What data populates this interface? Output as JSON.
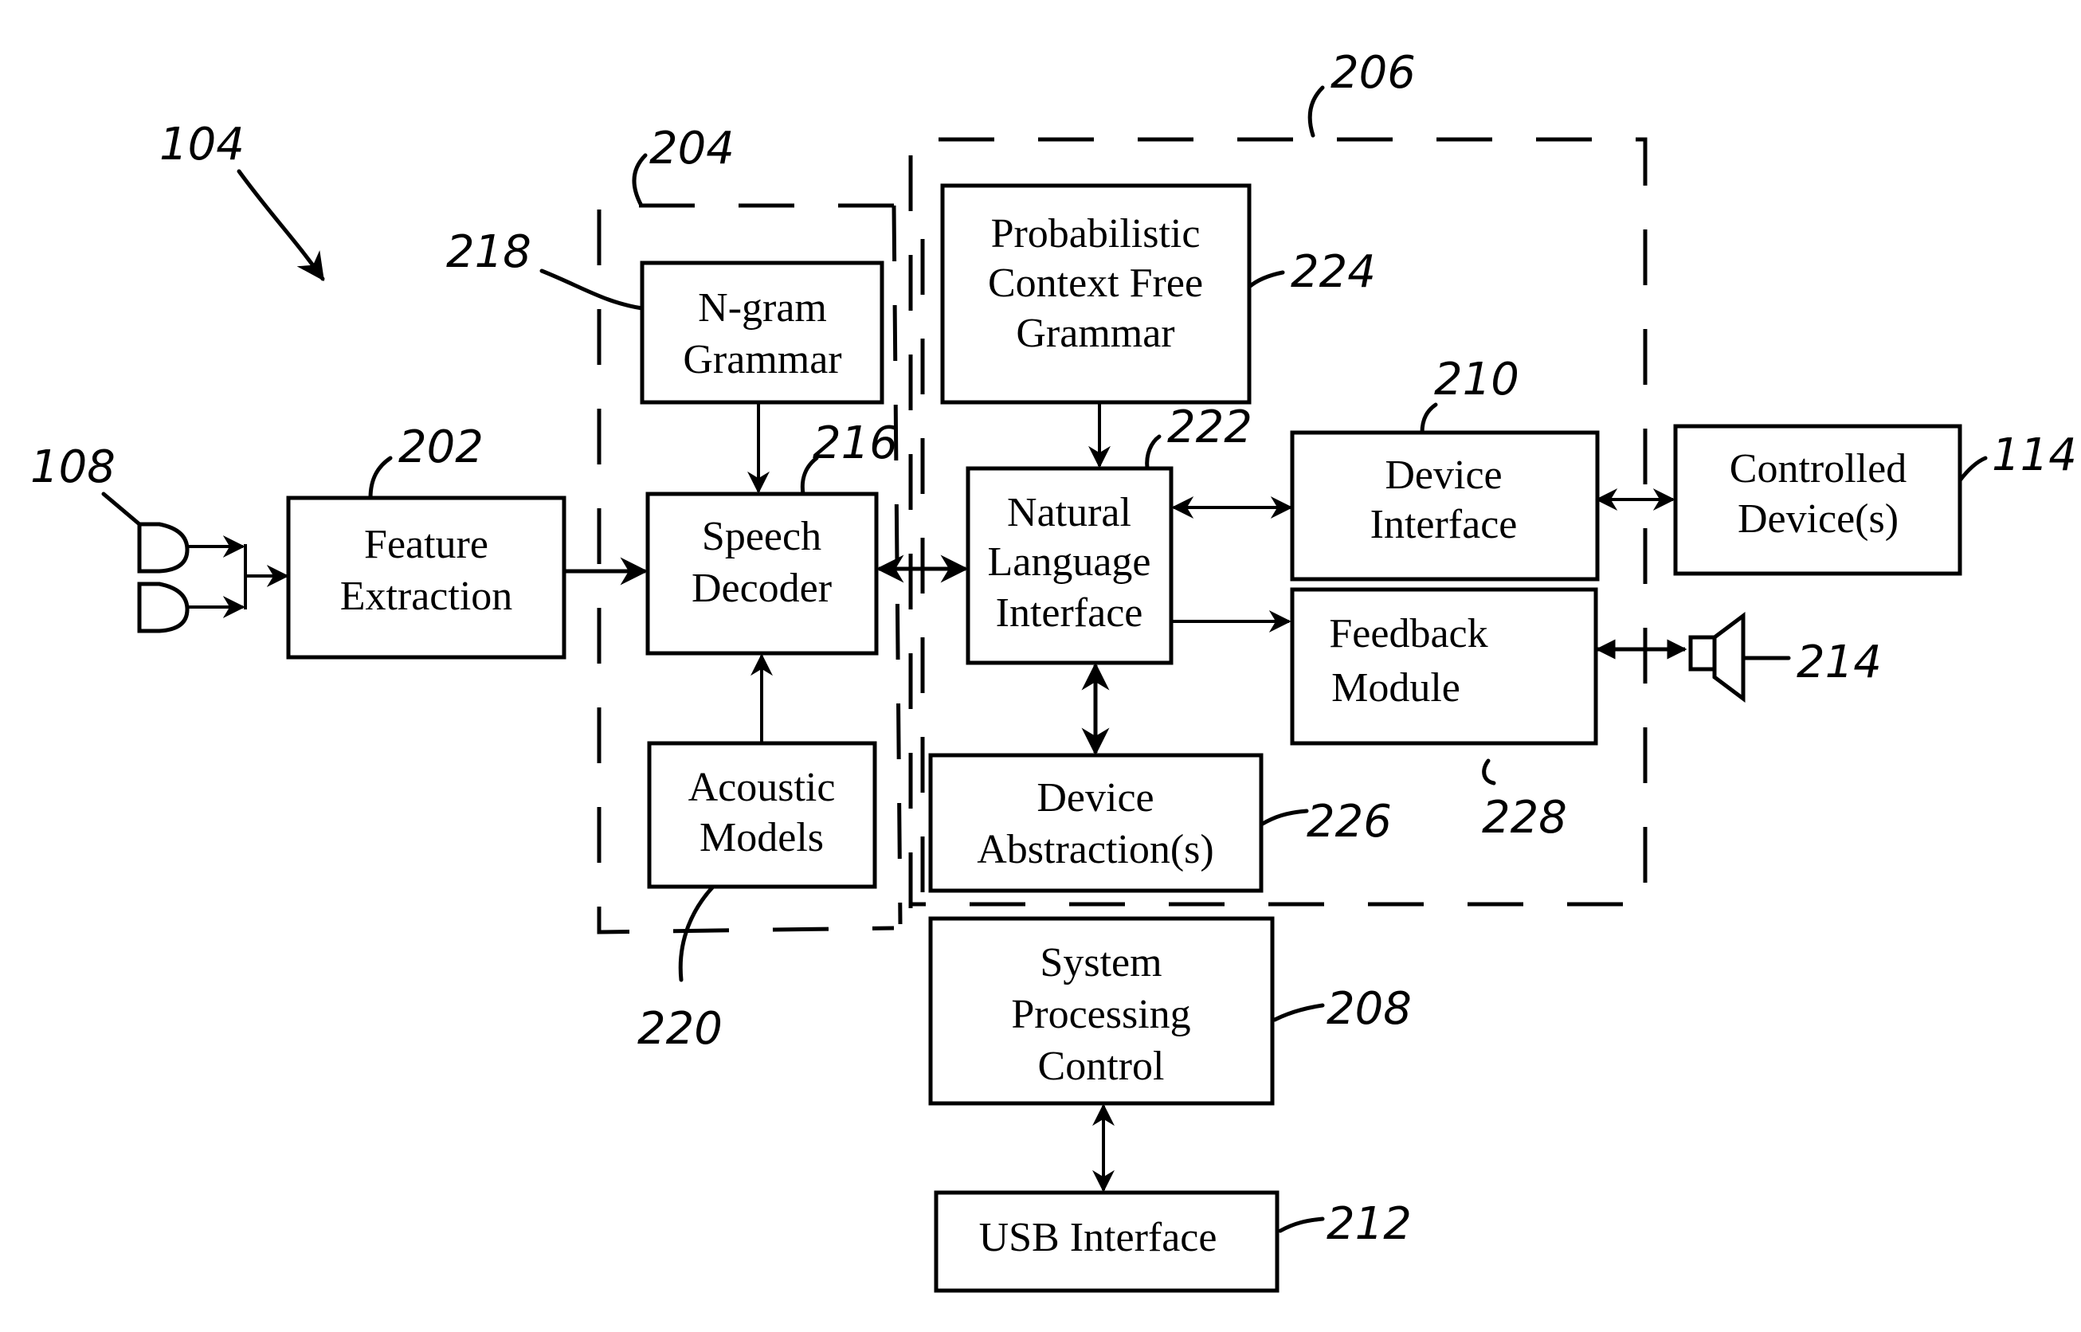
{
  "figure": {
    "title_ref": "104",
    "blocks": {
      "feature_extraction": {
        "ref": "202",
        "lines": [
          "Feature",
          "Extraction"
        ]
      },
      "ngram_grammar": {
        "ref": "218",
        "lines": [
          "N-gram",
          "Grammar"
        ]
      },
      "speech_decoder": {
        "ref": "216",
        "lines": [
          "Speech",
          "Decoder"
        ]
      },
      "acoustic_models": {
        "ref": "220",
        "lines": [
          "Acoustic",
          "Models"
        ]
      },
      "pcfg": {
        "ref": "224",
        "lines": [
          "Probabilistic",
          "Context Free",
          "Grammar"
        ]
      },
      "nli": {
        "ref": "222",
        "lines": [
          "Natural",
          "Language",
          "Interface"
        ]
      },
      "device_interface": {
        "ref": "210",
        "lines": [
          "Device",
          "Interface"
        ]
      },
      "feedback_module": {
        "ref": "228",
        "lines": [
          "Feedback",
          "Module"
        ]
      },
      "controlled_devices": {
        "ref": "114",
        "lines": [
          "Controlled",
          "Device(s)"
        ]
      },
      "device_abstraction": {
        "ref": "226",
        "lines": [
          "Device",
          "Abstraction(s)"
        ]
      },
      "system_processing": {
        "ref": "208",
        "lines": [
          "System",
          "Processing",
          "Control"
        ]
      },
      "usb_interface": {
        "ref": "212",
        "lines": [
          "USB Interface"
        ]
      }
    },
    "groups": {
      "recognizer_group": {
        "ref": "204"
      },
      "nl_group": {
        "ref": "206"
      }
    },
    "peripherals": {
      "microphones": {
        "ref": "108",
        "icon": "microphone-icon"
      },
      "speaker": {
        "ref": "214",
        "icon": "speaker-icon"
      }
    }
  }
}
